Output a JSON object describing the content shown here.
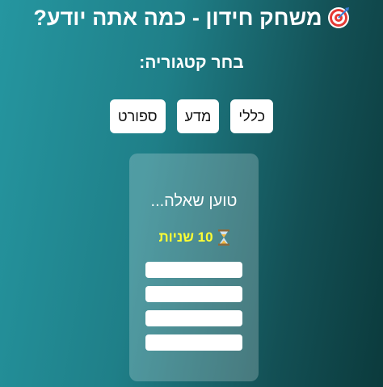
{
  "header": {
    "title": "משחק חידון - כמה אתה יודע?",
    "title_icon": "target-icon"
  },
  "category_prompt": "בחר קטגוריה:",
  "categories": [
    {
      "label": "ספורט"
    },
    {
      "label": "מדע"
    },
    {
      "label": "כללי"
    }
  ],
  "quiz": {
    "question_text": "טוען שאלה...",
    "timer_text": "10 שניות",
    "timer_icon": "hourglass-icon",
    "timer_color": "#ffff33",
    "answers": [
      {
        "label": ""
      },
      {
        "label": ""
      },
      {
        "label": ""
      },
      {
        "label": ""
      }
    ]
  },
  "colors": {
    "background_start": "#2596a0",
    "background_end": "#0b3a3c",
    "button_bg": "#ffffff"
  }
}
